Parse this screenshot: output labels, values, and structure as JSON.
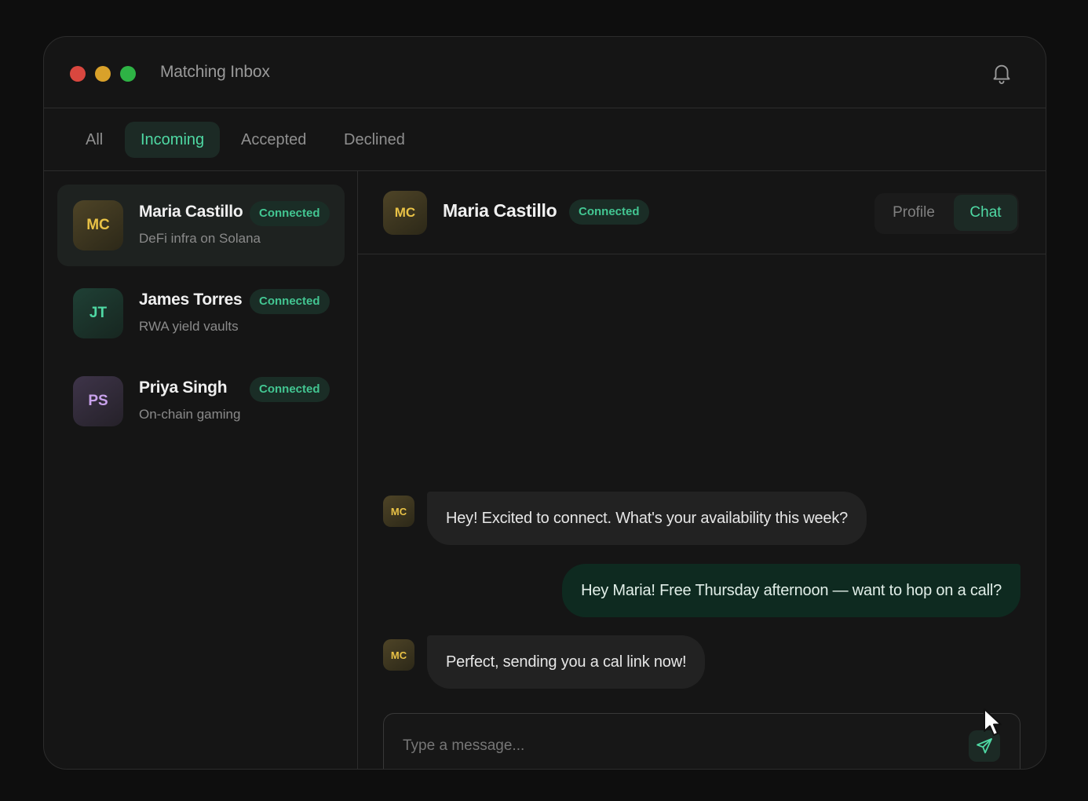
{
  "window": {
    "title": "Matching Inbox"
  },
  "filters": [
    {
      "label": "All",
      "active": false
    },
    {
      "label": "Incoming",
      "active": true
    },
    {
      "label": "Accepted",
      "active": false
    },
    {
      "label": "Declined",
      "active": false
    }
  ],
  "contacts": [
    {
      "initials": "MC",
      "name": "Maria Castillo",
      "subtitle": "DeFi infra on Solana",
      "status": "Connected",
      "selected": true
    },
    {
      "initials": "JT",
      "name": "James Torres",
      "subtitle": "RWA yield vaults",
      "status": "Connected",
      "selected": false
    },
    {
      "initials": "PS",
      "name": "Priya Singh",
      "subtitle": "On-chain gaming",
      "status": "Connected",
      "selected": false
    }
  ],
  "conversation": {
    "initials": "MC",
    "name": "Maria Castillo",
    "status": "Connected",
    "view_toggle": {
      "profile_label": "Profile",
      "chat_label": "Chat",
      "active": "Chat"
    },
    "messages": [
      {
        "from": "them",
        "initials": "MC",
        "text": "Hey! Excited to connect. What's your availability this week?"
      },
      {
        "from": "me",
        "text": "Hey Maria! Free Thursday afternoon — want to hop on a call?"
      },
      {
        "from": "them",
        "initials": "MC",
        "text": "Perfect, sending you a cal link now!"
      }
    ]
  },
  "composer": {
    "placeholder": "Type a message...",
    "value": ""
  },
  "icons": {
    "notifications": "bell-icon",
    "send": "send-icon",
    "pointer": "cursor-icon"
  },
  "colors": {
    "accent": "#4fd9a4",
    "badge_bg": "#1a2d26",
    "outgoing_bubble": "#0e2a20",
    "background": "#151515"
  }
}
